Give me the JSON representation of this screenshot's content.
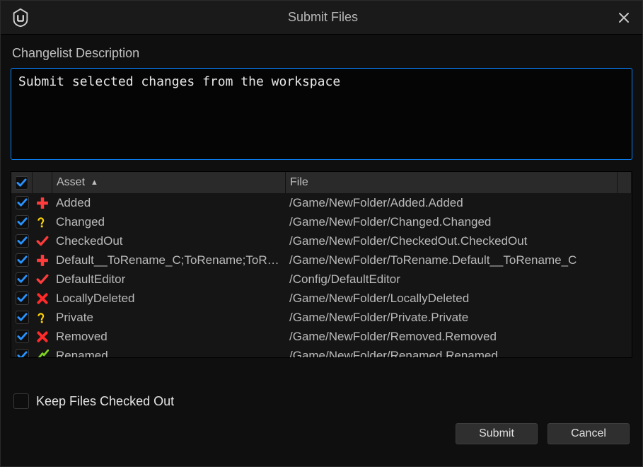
{
  "window": {
    "title": "Submit Files"
  },
  "description": {
    "label": "Changelist Description",
    "value": "Submit selected changes from the workspace"
  },
  "table": {
    "headers": {
      "asset": "Asset",
      "file": "File"
    },
    "sort_column": "asset",
    "sort_dir": "asc",
    "select_all": true,
    "rows": [
      {
        "checked": true,
        "status": "added",
        "asset": "Added",
        "file": "/Game/NewFolder/Added.Added"
      },
      {
        "checked": true,
        "status": "changed",
        "asset": "Changed",
        "file": "/Game/NewFolder/Changed.Changed"
      },
      {
        "checked": true,
        "status": "checkedout",
        "asset": "CheckedOut",
        "file": "/Game/NewFolder/CheckedOut.CheckedOut"
      },
      {
        "checked": true,
        "status": "added",
        "asset": "Default__ToRename_C;ToRename;ToRename",
        "file": "/Game/NewFolder/ToRename.Default__ToRename_C"
      },
      {
        "checked": true,
        "status": "checkedout",
        "asset": "DefaultEditor",
        "file": "/Config/DefaultEditor"
      },
      {
        "checked": true,
        "status": "deleted",
        "asset": "LocallyDeleted",
        "file": "/Game/NewFolder/LocallyDeleted"
      },
      {
        "checked": true,
        "status": "changed",
        "asset": "Private",
        "file": "/Game/NewFolder/Private.Private"
      },
      {
        "checked": true,
        "status": "deleted",
        "asset": "Removed",
        "file": "/Game/NewFolder/Removed.Removed"
      },
      {
        "checked": true,
        "status": "renamed",
        "asset": "Renamed",
        "file": "/Game/NewFolder/Renamed.Renamed"
      }
    ]
  },
  "keep_checked_out": {
    "label": "Keep Files Checked Out",
    "checked": false
  },
  "buttons": {
    "submit": "Submit",
    "cancel": "Cancel"
  },
  "icons": {
    "added": {
      "color": "#ff3b3b"
    },
    "changed": {
      "color": "#ffd400"
    },
    "checkedout": {
      "color": "#ff3b3b"
    },
    "deleted": {
      "color": "#ff2a2a"
    },
    "renamed": {
      "color": "#7ed321"
    }
  }
}
